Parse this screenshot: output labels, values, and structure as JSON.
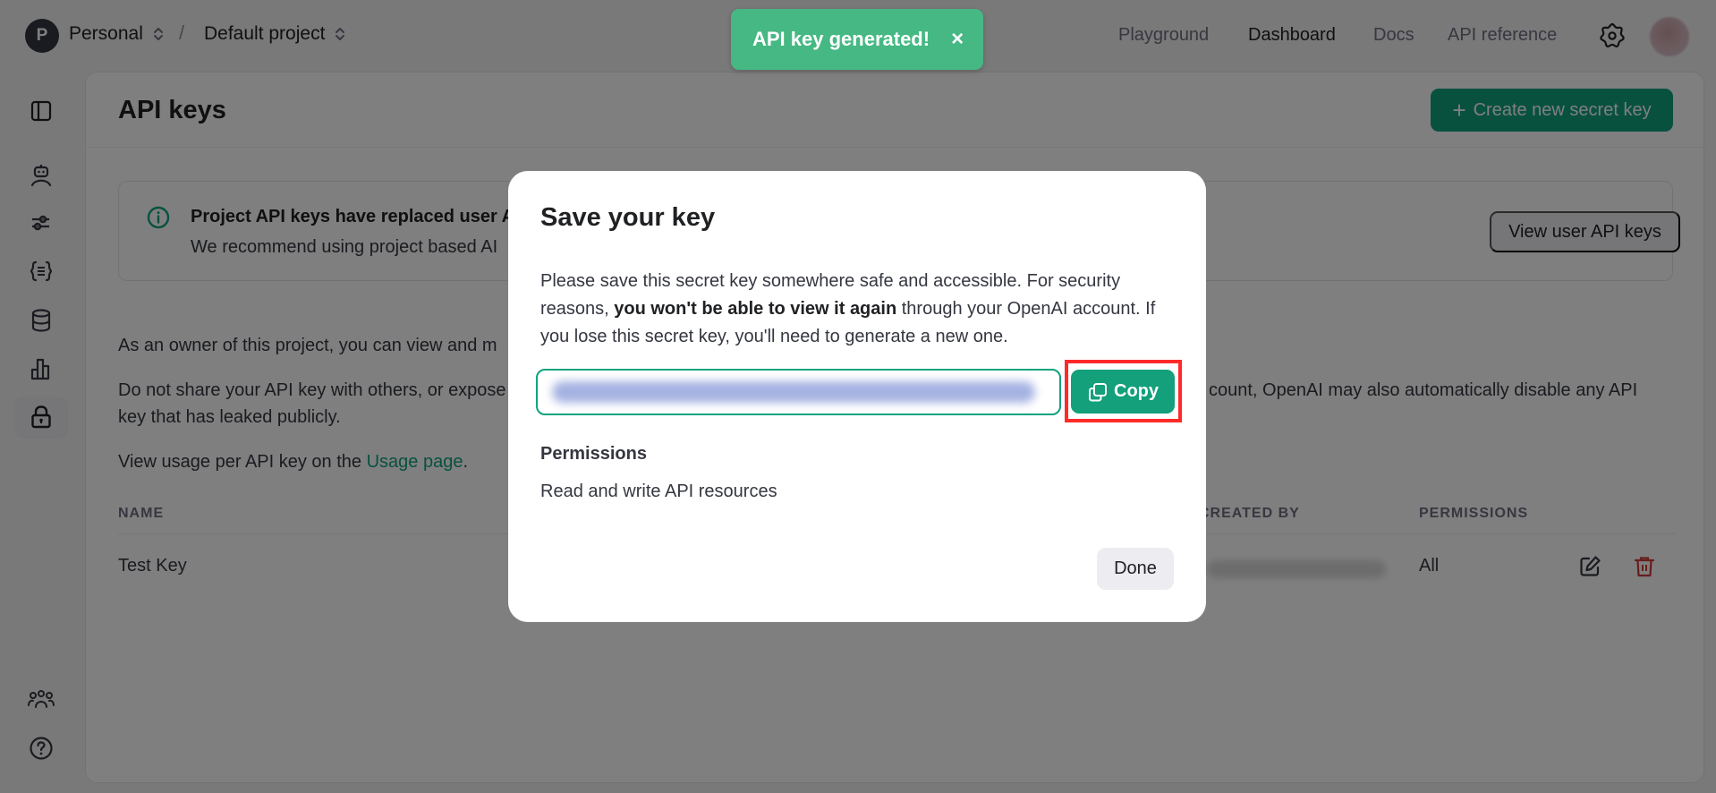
{
  "header": {
    "org_initial": "P",
    "org_name": "Personal",
    "separator": "/",
    "project_name": "Default project",
    "nav": [
      {
        "label": "Playground",
        "active": false
      },
      {
        "label": "Dashboard",
        "active": true
      },
      {
        "label": "Docs",
        "active": false
      },
      {
        "label": "API reference",
        "active": false
      }
    ],
    "settings_icon": "gear-icon",
    "avatar_icon": "user-avatar"
  },
  "sidebar": {
    "items": [
      {
        "icon": "sidebar-toggle-icon"
      },
      {
        "icon": "assistant-robot-icon"
      },
      {
        "icon": "sliders-icon"
      },
      {
        "icon": "braces-icon"
      },
      {
        "icon": "database-icon"
      },
      {
        "icon": "bar-chart-icon"
      },
      {
        "icon": "lock-icon",
        "active": true
      },
      {
        "icon": "team-icon"
      },
      {
        "icon": "help-icon"
      }
    ]
  },
  "page": {
    "title": "API keys",
    "create_button": {
      "icon": "+",
      "label": "Create new secret key"
    },
    "banner": {
      "title": "Project API keys have replaced user A",
      "text": "We recommend using project based AI",
      "button": "View user API keys"
    },
    "paragraph_owner": "As an owner of this project, you can view and m",
    "paragraph_share_left": "Do not share your API key with others, or expose",
    "paragraph_share_right": "count, OpenAI may also automatically disable any API",
    "paragraph_share_line2": "key that has leaked publicly.",
    "usage_prefix": "View usage per API key on the ",
    "usage_link": "Usage page",
    "usage_suffix": ".",
    "table": {
      "columns": [
        "NAME",
        "CREATED BY",
        "PERMISSIONS"
      ],
      "rows": [
        {
          "name": "Test Key",
          "created_by": "",
          "permissions": "All"
        }
      ]
    }
  },
  "toast": {
    "message": "API key generated!",
    "close": "×"
  },
  "modal": {
    "title": "Save your key",
    "body_part1": "Please save this secret key somewhere safe and accessible. For security reasons, ",
    "body_bold": "you won't be able to view it again",
    "body_part2": " through your OpenAI account. If you lose this secret key, you'll need to generate a new one.",
    "key_value": "",
    "copy_label": "Copy",
    "permissions_label": "Permissions",
    "permissions_value": "Read and write API resources",
    "done_label": "Done"
  },
  "colors": {
    "accent_green": "#10a37f",
    "toast_green": "#46b883",
    "highlight_red": "#ff2a2a",
    "delete_red": "#d33a3a"
  }
}
